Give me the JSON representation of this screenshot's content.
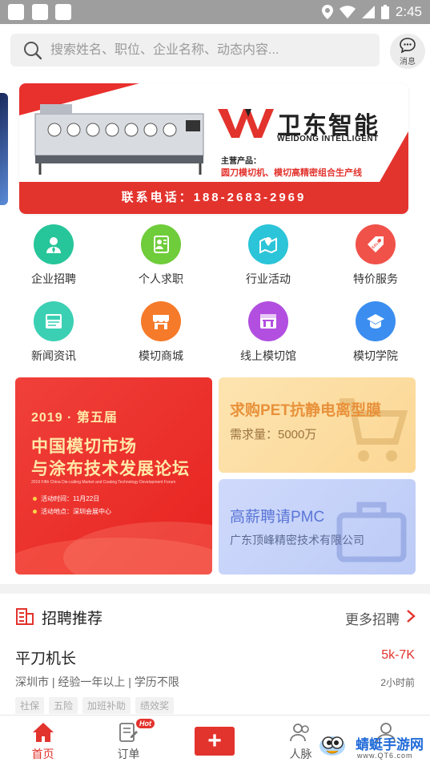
{
  "status_bar": {
    "time": "2:45"
  },
  "header": {
    "search_placeholder": "搜索姓名、职位、企业名称、动态内容...",
    "message_label": "消息"
  },
  "banner": {
    "brand_cn": "卫东智能",
    "brand_en": "WEIDONG INTELLIGENT",
    "products_label": "主营产品：",
    "products": "圆刀模切机、模切高精密组合生产线",
    "phone": "联系电话：188-2683-2969"
  },
  "nav": [
    {
      "label": "企业招聘",
      "icon": "person-badge-icon",
      "color": "#27c59a"
    },
    {
      "label": "个人求职",
      "icon": "resume-icon",
      "color": "#6fcc3a"
    },
    {
      "label": "行业活动",
      "icon": "map-pin-icon",
      "color": "#2bc4d8"
    },
    {
      "label": "特价服务",
      "icon": "sale-tag-icon",
      "color": "#f0524a"
    },
    {
      "label": "新闻资讯",
      "icon": "news-icon",
      "color": "#3bd0b4"
    },
    {
      "label": "模切商城",
      "icon": "store-icon",
      "color": "#f57a2a"
    },
    {
      "label": "线上模切馆",
      "icon": "pavilion-icon",
      "color": "#b24fe0"
    },
    {
      "label": "模切学院",
      "icon": "graduation-cap-icon",
      "color": "#3b8ef0"
    }
  ],
  "promo_big": {
    "year_line": "2019 · 第五届",
    "title_line1": "中国模切市场",
    "title_line2": "与涂布技术发展论坛",
    "title_en": "2019 Fifth China Die-cutting Market and Coating Technology Development Forum",
    "date": "活动时间：11月22日",
    "venue": "活动地点：深圳会展中心"
  },
  "promo_yellow": {
    "title": "求购PET抗静电离型膜",
    "sub": "需求量：5000万"
  },
  "promo_blue": {
    "title": "高薪聘请PMC",
    "sub": "广东顶峰精密技术有限公司"
  },
  "recruit": {
    "title": "招聘推荐",
    "more": "更多招聘",
    "jobs": [
      {
        "title": "平刀机长",
        "salary": "5k-7K",
        "meta": "深圳市 | 经验一年以上 | 学历不限",
        "time": "2小时前",
        "tags": [
          "社保",
          "五险",
          "加班补助",
          "绩效奖"
        ]
      }
    ]
  },
  "bottom_nav": {
    "home": "首页",
    "orders": "订单",
    "hot": "Hot",
    "add": "+",
    "contacts": "人脉"
  },
  "watermark": {
    "name": "蜻蜓手游网",
    "url": "www.QT6.com"
  },
  "colors": {
    "accent": "#e3332d"
  }
}
